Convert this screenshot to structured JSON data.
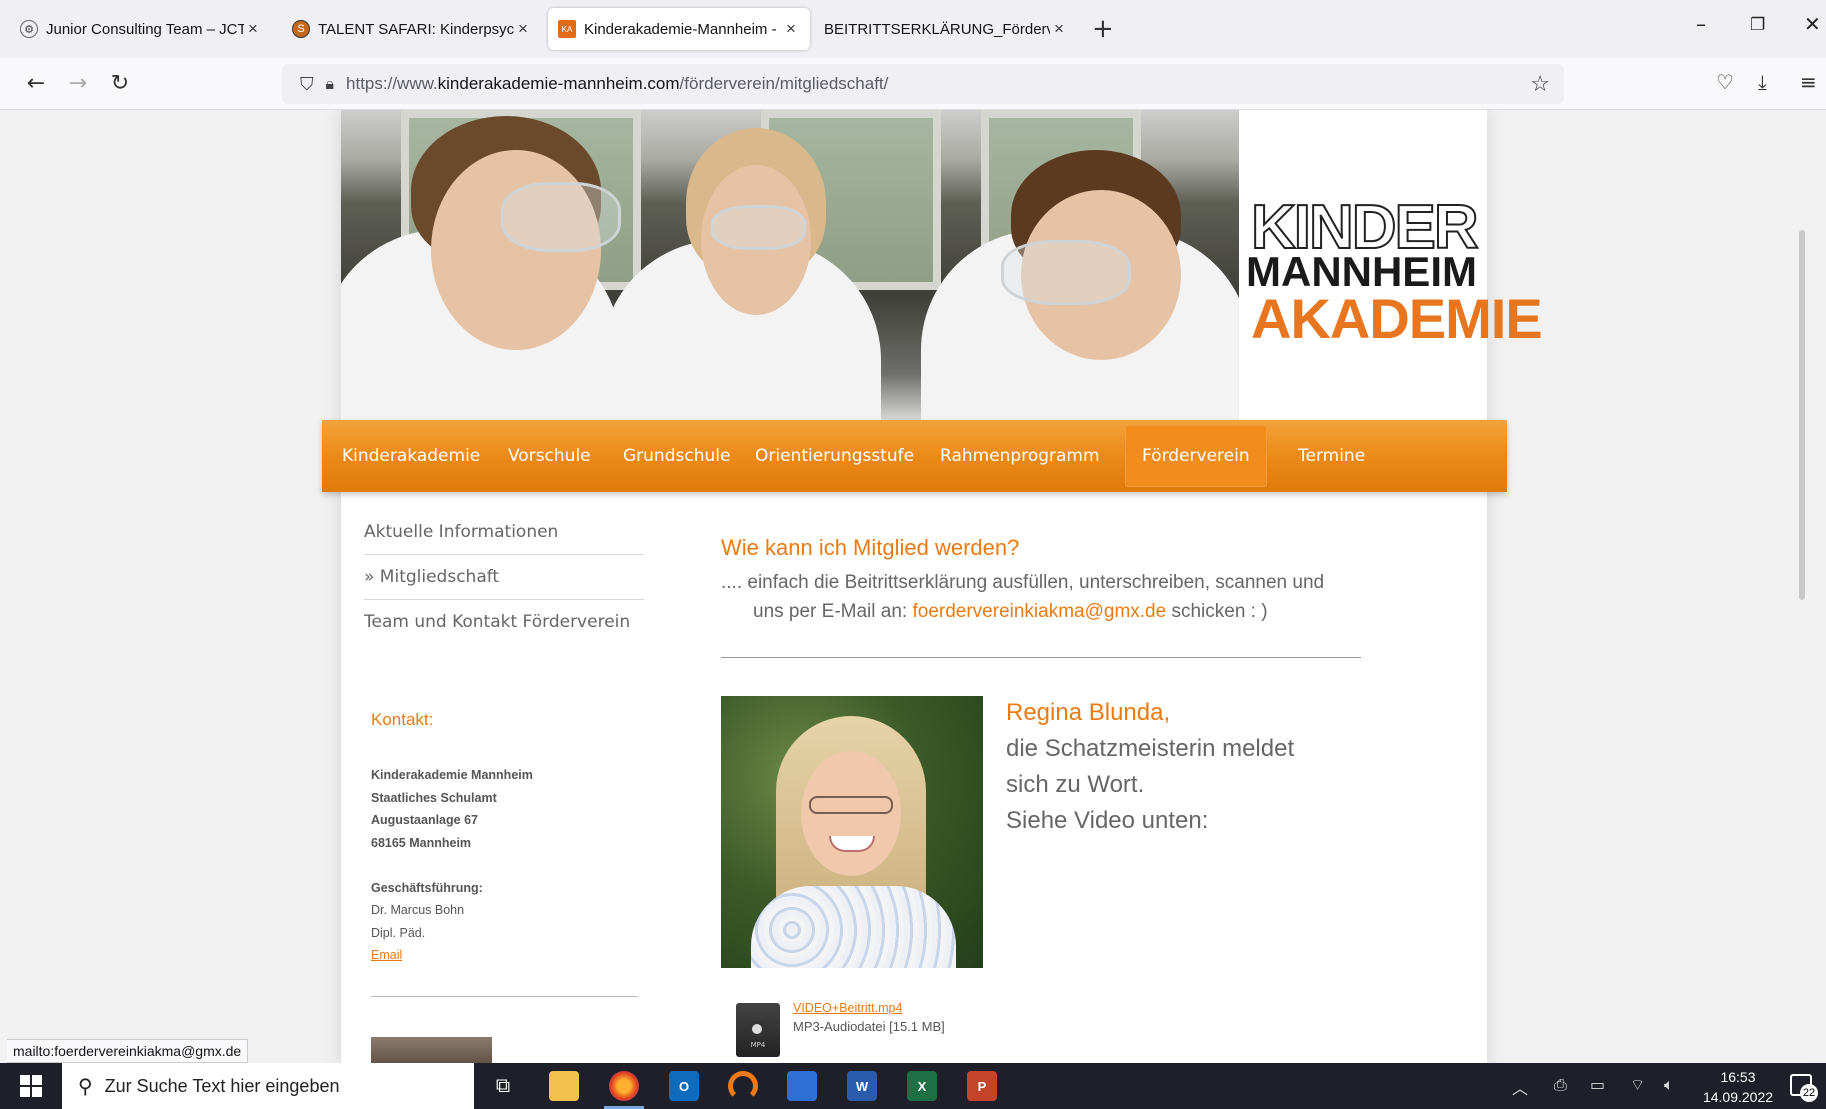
{
  "browser": {
    "tabs": [
      {
        "label": "Junior Consulting Team – JCT Stu",
        "icon": "jct-favicon",
        "active": false
      },
      {
        "label": "TALENT SAFARI: Kinderpsycholo",
        "icon": "talent-safari-favicon",
        "active": false
      },
      {
        "label": "Kinderakademie-Mannheim - M",
        "icon": "kinderakademie-favicon",
        "active": true
      },
      {
        "label": "BEITRITTSERKLÄRUNG_Förderverein",
        "icon": "",
        "active": false
      }
    ],
    "url_prefix": "https://www.",
    "url_domain": "kinderakademie-mannheim.com",
    "url_path": "/förderverein/mitgliedschaft/",
    "status_text": "mailto:foerdervereinkiakma@gmx.de"
  },
  "site": {
    "logo": {
      "line1": "KINDER",
      "line2": "MANNHEIM",
      "line3": "AKADEMIE"
    },
    "menu": [
      "Kinderakademie",
      "Vorschule",
      "Grundschule",
      "Orientierungsstufe",
      "Rahmenprogramm",
      "Förderverein",
      "Termine"
    ],
    "menu_active": "Förderverein",
    "subnav": [
      {
        "label": "Aktuelle Informationen"
      },
      {
        "label": "» Mitgliedschaft"
      },
      {
        "label": "Team und Kontakt Förderverein"
      }
    ],
    "kontakt": {
      "title": "Kontakt:",
      "org": "Kinderakademie Mannheim",
      "line2": "Staatliches Schulamt",
      "street": "Augustaanlage 67",
      "city": "68165 Mannheim",
      "gf_label": "Geschäftsführung:",
      "gf_name": "Dr. Marcus Bohn",
      "gf_title": "Dipl. Päd.",
      "email_link": "Email"
    },
    "main": {
      "heading": "Wie kann ich Mitglied werden?",
      "intro_1": ".... einfach die Beitrittserklärung ausfüllen, unterschreiben, scannen und",
      "intro_2a": "uns per E-Mail an: ",
      "email": "foerdervereinkiakma@gmx.de",
      "intro_2b": " schicken : )",
      "person_name": "Regina Blunda,",
      "person_line1": "die Schatzmeisterin meldet",
      "person_line2": "sich zu Wort.",
      "person_line3": "Siehe Video unten:",
      "file_label": "VIDEO+Beitritt.mp4",
      "file_meta": "MP3-Audiodatei [15.1 MB]",
      "file_icon_text": "MP4"
    }
  },
  "taskbar": {
    "search_placeholder": "Zur Suche Text hier eingeben",
    "time": "16:53",
    "date": "14.09.2022",
    "notifications": "22"
  },
  "colors": {
    "accent": "#ea7b10",
    "menu": "#ec8a18"
  }
}
